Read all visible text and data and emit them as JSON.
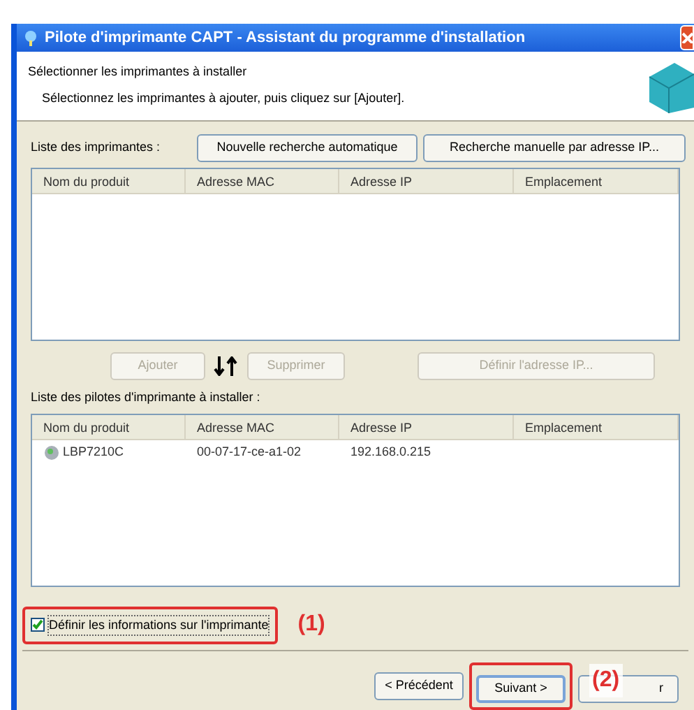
{
  "window": {
    "title": "Pilote d'imprimante CAPT - Assistant du programme d'installation"
  },
  "header": {
    "title": "Sélectionner les imprimantes à installer",
    "subtitle": "Sélectionnez les imprimantes à ajouter, puis cliquez sur [Ajouter]."
  },
  "printer_list": {
    "label": "Liste des imprimantes :",
    "buttons": [
      "Nouvelle recherche automatique",
      "Recherche manuelle par adresse IP..."
    ],
    "columns": [
      "Nom du produit",
      "Adresse MAC",
      "Adresse IP",
      "Emplacement"
    ]
  },
  "list_actions": [
    {
      "label": "Ajouter",
      "disabled": true
    },
    {
      "label": "Supprimer",
      "disabled": true
    },
    {
      "label": "Définir l'adresse IP...",
      "disabled": true
    }
  ],
  "driver_list": {
    "label": "Liste des pilotes d'imprimante à installer :",
    "columns": [
      "Nom du produit",
      "Adresse MAC",
      "Adresse IP",
      "Emplacement"
    ],
    "rows": [
      {
        "cells": [
          "LBP7210C",
          "00-07-17-ce-a1-02",
          "192.168.0.215"
        ]
      }
    ]
  },
  "option": {
    "label": "Définir les informations sur l'imprimante",
    "checked": true
  },
  "nav_buttons": [
    {
      "label": "< Précédent",
      "default": false
    },
    {
      "label": "Suivant >",
      "default": true
    },
    {
      "label": "r",
      "default": false
    }
  ],
  "callouts": [
    {
      "label": "(1)"
    },
    {
      "label": "(2)"
    }
  ]
}
